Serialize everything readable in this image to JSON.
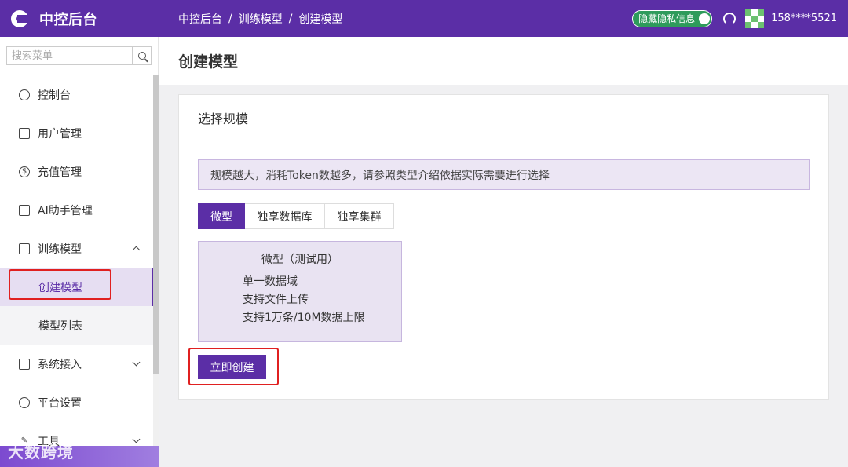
{
  "app": {
    "logo_icon": "logo-icon",
    "title": "中控后台"
  },
  "breadcrumb": [
    "中控后台",
    "训练模型",
    "创建模型"
  ],
  "header": {
    "privacy_toggle_label": "隐藏隐私信息",
    "privacy_toggle_on": true,
    "support_icon": "headset-icon",
    "user_phone": "158****5521"
  },
  "sidebar": {
    "search_placeholder": "搜索菜单",
    "items": [
      {
        "label": "控制台",
        "icon": "dashboard-icon"
      },
      {
        "label": "用户管理",
        "icon": "id-card-icon"
      },
      {
        "label": "充值管理",
        "icon": "dollar-icon"
      },
      {
        "label": "AI助手管理",
        "icon": "assistant-icon"
      },
      {
        "label": "训练模型",
        "icon": "list-icon",
        "expanded": true,
        "children": [
          {
            "label": "创建模型",
            "active": true
          },
          {
            "label": "模型列表"
          }
        ]
      },
      {
        "label": "系统接入",
        "icon": "grid-icon",
        "expanded": false
      },
      {
        "label": "平台设置",
        "icon": "gear-icon"
      },
      {
        "label": "工具",
        "icon": "wrench-icon",
        "expanded": false
      }
    ],
    "watermark": "大数跨境"
  },
  "main": {
    "page_title": "创建模型",
    "card_title": "选择规模",
    "notice": "规模越大，消耗Token数越多，请参照类型介绍依据实际需要进行选择",
    "tabs": [
      {
        "label": "微型",
        "active": true
      },
      {
        "label": "独享数据库",
        "active": false
      },
      {
        "label": "独享集群",
        "active": false
      }
    ],
    "tier": {
      "title": "微型（测试用）",
      "features": [
        "单一数据域",
        "支持文件上传",
        "支持1万条/10M数据上限"
      ]
    },
    "create_button": "立即创建"
  },
  "colors": {
    "primary": "#5b2ea6",
    "highlight": "#e02020",
    "toggle_on": "#2e9b5b"
  }
}
